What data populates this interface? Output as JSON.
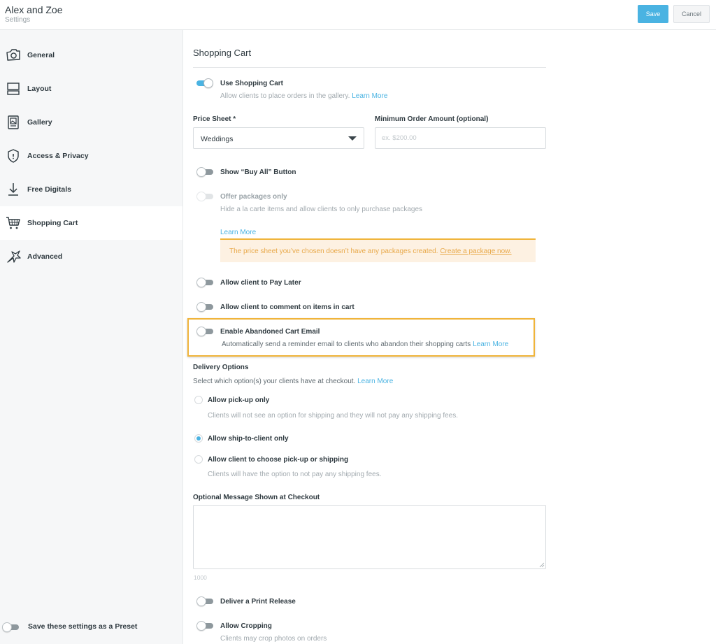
{
  "header": {
    "title": "Alex and Zoe",
    "subtitle": "Settings",
    "save_label": "Save",
    "cancel_label": "Cancel"
  },
  "sidebar": {
    "items": [
      {
        "label": "General",
        "icon": "camera-icon"
      },
      {
        "label": "Layout",
        "icon": "layout-icon"
      },
      {
        "label": "Gallery",
        "icon": "gallery-icon"
      },
      {
        "label": "Access & Privacy",
        "icon": "shield-icon"
      },
      {
        "label": "Free Digitals",
        "icon": "download-icon"
      },
      {
        "label": "Shopping Cart",
        "icon": "cart-icon"
      },
      {
        "label": "Advanced",
        "icon": "wand-icon"
      }
    ],
    "active": "Shopping Cart",
    "preset_label": "Save these settings as a Preset"
  },
  "main": {
    "section_title": "Shopping Cart",
    "use_cart": {
      "label": "Use Shopping Cart",
      "desc": "Allow clients to place orders in the gallery.",
      "link": "Learn More",
      "enabled": true
    },
    "price_sheet": {
      "label": "Price Sheet *",
      "value": "Weddings"
    },
    "min_order": {
      "label": "Minimum Order Amount (optional)",
      "placeholder": "ex. $200.00"
    },
    "buy_all": {
      "label": "Show “Buy All” Button",
      "enabled": false
    },
    "packages_only": {
      "label": "Offer packages only",
      "desc": "Hide a la carte items and allow clients to only purchase packages",
      "link": "Learn More",
      "disabled": true
    },
    "warning": {
      "text": "The price sheet you’ve chosen doesn’t have any packages created.",
      "link": "Create a package now."
    },
    "pay_later": {
      "label": "Allow client to Pay Later",
      "enabled": false
    },
    "comment": {
      "label": "Allow client to comment on items in cart",
      "enabled": false
    },
    "abandoned": {
      "label": "Enable Abandoned Cart Email",
      "desc": "Automatically send a reminder email to clients who abandon their shopping carts",
      "link": "Learn More",
      "enabled": false
    },
    "delivery": {
      "title": "Delivery Options",
      "desc": "Select which option(s) your clients have at checkout.",
      "link": "Learn More",
      "options": [
        {
          "label": "Allow pick-up only",
          "desc": "Clients will not see an option for shipping and they will not pay any shipping fees.",
          "selected": false
        },
        {
          "label": "Allow ship-to-client only",
          "desc": "",
          "selected": true
        },
        {
          "label": "Allow client to choose pick-up or shipping",
          "desc": "Clients will have the option to not pay any shipping fees.",
          "selected": false
        }
      ]
    },
    "message": {
      "label": "Optional Message Shown at Checkout",
      "value": "",
      "counter": "1000"
    },
    "print_release": {
      "label": "Deliver a Print Release",
      "enabled": false
    },
    "cropping": {
      "label": "Allow Cropping",
      "desc": "Clients may crop photos on orders",
      "enabled": false
    }
  }
}
